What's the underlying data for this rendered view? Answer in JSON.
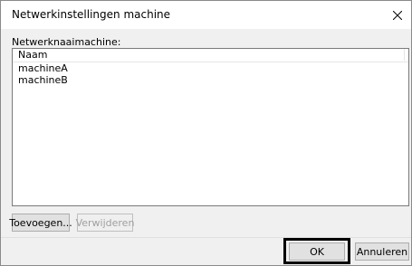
{
  "window": {
    "title": "Netwerkinstellingen machine",
    "close_glyph": "✕"
  },
  "network": {
    "label": "Netwerknaaimachine:",
    "column_header": "Naam",
    "items": [
      "machineA",
      "machineB"
    ]
  },
  "buttons": {
    "add": "Toevoegen...",
    "remove": "Verwijderen",
    "ok": "OK",
    "cancel": "Annuleren"
  },
  "icons": {
    "close": "close-icon"
  },
  "colors": {
    "window_bg": "#f0f0f0",
    "button_bg": "#e1e1e1",
    "highlight_outline": "#000000"
  }
}
